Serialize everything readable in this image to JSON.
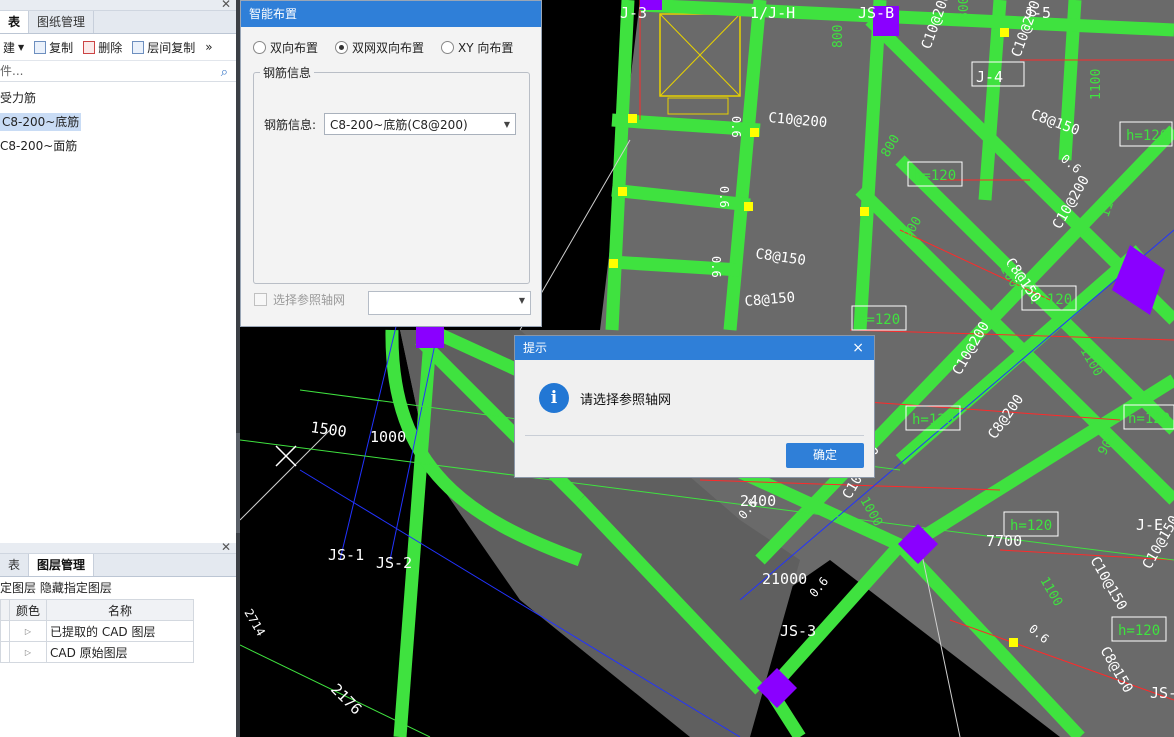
{
  "left_panel": {
    "top_tabs": [
      "表",
      "图纸管理"
    ],
    "toolbar": {
      "new_label": "建",
      "copy_label": "复制",
      "delete_label": "删除",
      "floor_copy_label": "层间复制",
      "more_label": "»"
    },
    "search": {
      "placeholder": "件..."
    },
    "tree": {
      "group_label": "受力筋",
      "items": [
        "C8-200~底筋",
        "C8-200~面筋"
      ],
      "selected_index": 0
    },
    "lower_tabs": [
      "表",
      "图层管理"
    ],
    "lower_toolbar": {
      "show_label": "定图层",
      "hide_label": "隐藏指定图层"
    },
    "layers_table": {
      "headers": [
        "颜色",
        "名称"
      ],
      "rows": [
        "已提取的 CAD 图层",
        "CAD 原始图层"
      ]
    }
  },
  "smart_dialog": {
    "title": "智能布置",
    "options": [
      "双向布置",
      "双网双向布置",
      "XY 向布置"
    ],
    "selected_option": 1,
    "group_title": "钢筋信息",
    "rebar_label": "钢筋信息:",
    "rebar_value": "C8-200~底筋(C8@200)",
    "axis_checkbox_label": "选择参照轴网",
    "axis_checked": false
  },
  "alert_dialog": {
    "title": "提示",
    "message": "请选择参照轴网",
    "ok_label": "确定",
    "close_glyph": "×"
  },
  "cad": {
    "labels": [
      "J-3",
      "1/J-H",
      "JS-B",
      "J-5",
      "J-4",
      "JS-1",
      "JS-2",
      "JS-3",
      "J-E",
      "JS-"
    ],
    "dims": [
      "1500",
      "1000",
      "2400",
      "21000",
      "7700",
      "2714",
      "2176"
    ],
    "h_tags": [
      "h=120",
      "h=120",
      "h=120",
      "h=120",
      "h=120",
      "h=120",
      "h=120",
      "h=120"
    ],
    "rebar_notes": [
      "C10@200",
      "C8@150",
      "C8@150",
      "C8@150",
      "C10@200",
      "C10@200",
      "C10@200",
      "C8@200",
      "C8@150",
      "C10@150",
      "C8@150",
      "C10@200",
      "C10@150",
      "C10@100"
    ],
    "small_nums": [
      "800",
      "800",
      "800",
      "1100",
      "1100",
      "1000",
      "900",
      "1100",
      "1000",
      "900",
      "1100"
    ],
    "marks": [
      "0.6",
      "0.6",
      "0.6",
      "0.6",
      "0.6",
      "0.6",
      "0.6"
    ],
    "colors": {
      "beam": "#3fe23f",
      "slab": "#6a6a6a",
      "annot": "#ff2a2a",
      "column": "#8a00ff",
      "axis": "#2233ff"
    }
  }
}
